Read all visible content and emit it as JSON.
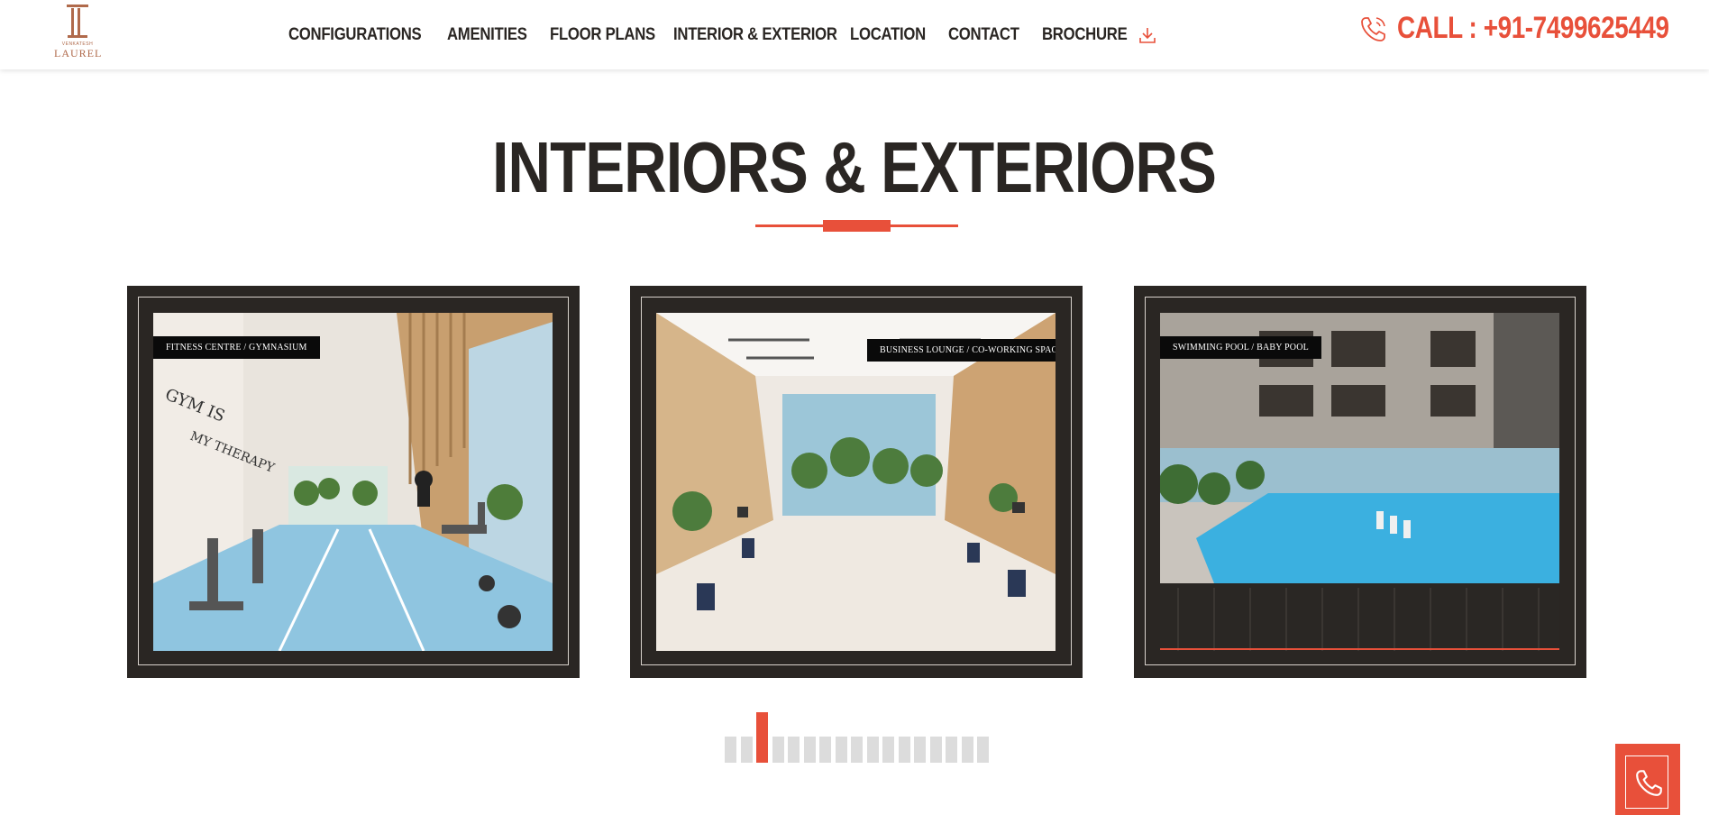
{
  "logo": {
    "small_text": "VENKATESH",
    "brand_text": "LAUREL",
    "brand_color": "#b06a4b"
  },
  "nav": {
    "items": [
      "CONFIGURATIONS",
      "AMENITIES",
      "FLOOR PLANS",
      "INTERIOR & EXTERIOR",
      "LOCATION",
      "CONTACT",
      "BROCHURE"
    ],
    "brochure_icon": "download-icon"
  },
  "header": {
    "call_text": "CALL : +91-7499625449",
    "call_icon": "phone-icon"
  },
  "section": {
    "title": "INTERIORS & EXTERIORS"
  },
  "gallery": {
    "cards": [
      {
        "label": "FITNESS CENTRE / GYMNASIUM"
      },
      {
        "label": "BUSINESS LOUNGE / CO-WORKING SPACE"
      },
      {
        "label": "SWIMMING POOL / BABY POOL"
      }
    ],
    "pagination": {
      "total": 17,
      "active_index": 2
    }
  },
  "fab": {
    "icon": "phone-icon"
  },
  "colors": {
    "accent": "#e8503a",
    "dark": "#2a2623",
    "inactive_dot": "#dcdcdc"
  }
}
